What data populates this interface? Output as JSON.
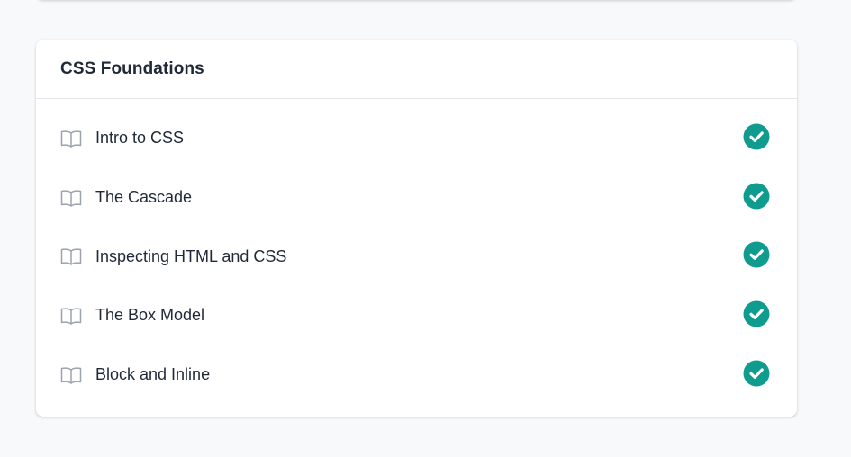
{
  "section": {
    "title": "CSS Foundations",
    "lessons": [
      {
        "title": "Intro to CSS",
        "icon": "book-open-icon",
        "status_icon": "check-circle-icon",
        "completed": true
      },
      {
        "title": "The Cascade",
        "icon": "book-open-icon",
        "status_icon": "check-circle-icon",
        "completed": true
      },
      {
        "title": "Inspecting HTML and CSS",
        "icon": "book-open-icon",
        "status_icon": "check-circle-icon",
        "completed": true
      },
      {
        "title": "The Box Model",
        "icon": "book-open-icon",
        "status_icon": "check-circle-icon",
        "completed": true
      },
      {
        "title": "Block and Inline",
        "icon": "book-open-icon",
        "status_icon": "check-circle-icon",
        "completed": true
      }
    ]
  },
  "colors": {
    "completed": "#0f9b8e",
    "icon_muted": "#9ca3af",
    "text": "#1f2937",
    "background": "#f8f9fb"
  }
}
